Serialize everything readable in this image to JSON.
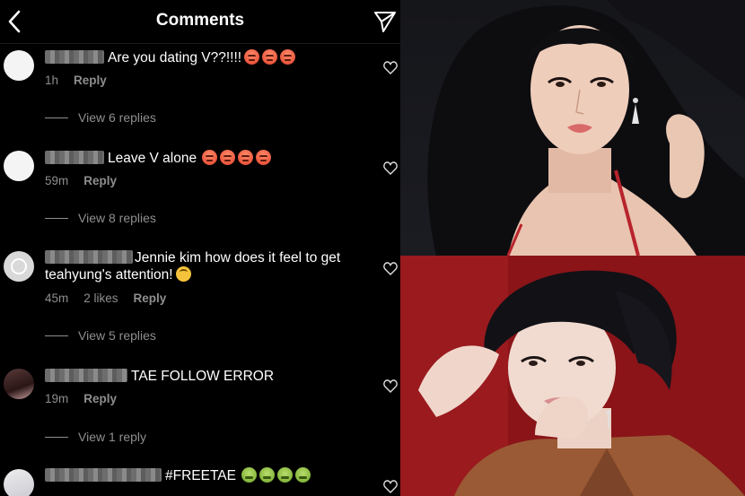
{
  "header": {
    "title": "Comments",
    "back_icon": "chevron-left-icon",
    "send_icon": "paper-plane-icon"
  },
  "comments": [
    {
      "text": "Are you dating V??!!!!",
      "time": "1h",
      "likes": "",
      "reply": "Reply",
      "view_replies": "View 6 replies",
      "emoji": [
        "angry",
        "angry",
        "angry"
      ]
    },
    {
      "text": "Leave V alone",
      "time": "59m",
      "likes": "",
      "reply": "Reply",
      "view_replies": "View 8 replies",
      "emoji": [
        "angry",
        "angry",
        "angry",
        "angry"
      ]
    },
    {
      "text": "Jennie kim how does it feel to get teahyung's attention!",
      "time": "45m",
      "likes": "2 likes",
      "reply": "Reply",
      "view_replies": "View 5 replies",
      "emoji": [
        "upside"
      ]
    },
    {
      "text": "TAE FOLLOW ERROR",
      "time": "19m",
      "likes": "",
      "reply": "Reply",
      "view_replies": "View 1 reply",
      "emoji": []
    },
    {
      "text": "#FREETAE",
      "time": "",
      "likes": "",
      "reply": "",
      "view_replies": "",
      "emoji": [
        "sick",
        "sick",
        "sick",
        "sick"
      ]
    }
  ],
  "colors": {
    "background": "#000000",
    "text": "#ffffff",
    "muted": "#8e8e8e",
    "tae_backdrop": "#8c1418"
  }
}
